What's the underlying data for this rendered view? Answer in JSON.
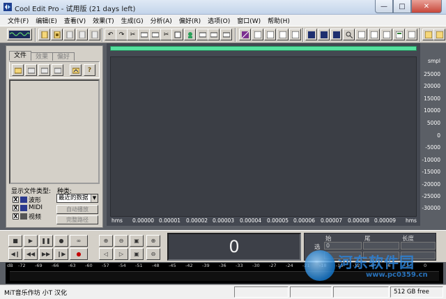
{
  "window": {
    "title": "Cool Edit Pro  - 试用版 (21 days left)",
    "minimize_icon": "minimize-icon",
    "maximize_icon": "maximize-icon",
    "close_icon": "close-icon"
  },
  "menu": [
    "文件(F)",
    "编辑(E)",
    "查看(V)",
    "效果(T)",
    "生成(G)",
    "分析(A)",
    "偏好(R)",
    "选项(O)",
    "窗口(W)",
    "帮助(H)"
  ],
  "toolbar": {
    "icons": [
      "multitrack-view-icon",
      "new-file-icon",
      "open-file-icon",
      "save-file-icon",
      "close-file-icon",
      "save-all-icon",
      "undo-icon",
      "redo-icon",
      "cut-icon",
      "copy-icon",
      "paste-icon",
      "mix-paste-icon",
      "trim-icon",
      "cue-icon",
      "settings-icon",
      "record-settings-icon",
      "play-list-icon",
      "equalizer-icon",
      "amplify-icon",
      "noise-icon",
      "view-icon",
      "waveform-icon",
      "spectral-icon",
      "zoom-icon",
      "markers-icon",
      "analysis-icon",
      "cdplayer-icon",
      "properties-icon",
      "exit-icon"
    ]
  },
  "organizer": {
    "tabs": [
      "文件",
      "效果",
      "偏好"
    ],
    "file_type_label": "显示文件类型:",
    "sort_label": "种类:",
    "file_types": [
      {
        "label": "波形",
        "checked": "X"
      },
      {
        "label": "MIDI",
        "checked": "X"
      },
      {
        "label": "视频",
        "checked": "X"
      }
    ],
    "sort_value": "最近的数据",
    "auto_play_label": "自动播放",
    "full_path_label": "完整路径"
  },
  "waveform": {
    "y_unit": "smpl",
    "y_ticks": [
      "25000",
      "20000",
      "15000",
      "10000",
      "5000",
      "0",
      "-5000",
      "-10000",
      "-15000",
      "-20000",
      "-25000",
      "-30000"
    ],
    "x_unit": "hms",
    "x_ticks": [
      "0.00000",
      "0.00001",
      "0.00002",
      "0.00003",
      "0.00004",
      "0.00005",
      "0.00006",
      "0.00007",
      "0.00008",
      "0.00009"
    ],
    "overview_color": "#55e19f",
    "background_color": "#3b3e45"
  },
  "time_display": "0",
  "selection": {
    "headers": [
      "始",
      "尾",
      "长度"
    ],
    "row_label": "选",
    "begin": "0",
    "end": "",
    "length": ""
  },
  "level_meter": {
    "ticks": [
      "dB",
      "-72",
      "-69",
      "-66",
      "-63",
      "-60",
      "-57",
      "-54",
      "-51",
      "-48",
      "-45",
      "-42",
      "-39",
      "-36",
      "-33",
      "-30",
      "-27",
      "-24",
      "-21",
      "-18",
      "-15",
      "-12",
      "-9",
      "-6",
      "-3",
      "0"
    ]
  },
  "status": {
    "text": "MiT音乐作坊 小T 汉化",
    "free_space": "512 GB free"
  },
  "watermark": {
    "text": "河东软件园",
    "url": "www.pc0359.cn"
  }
}
